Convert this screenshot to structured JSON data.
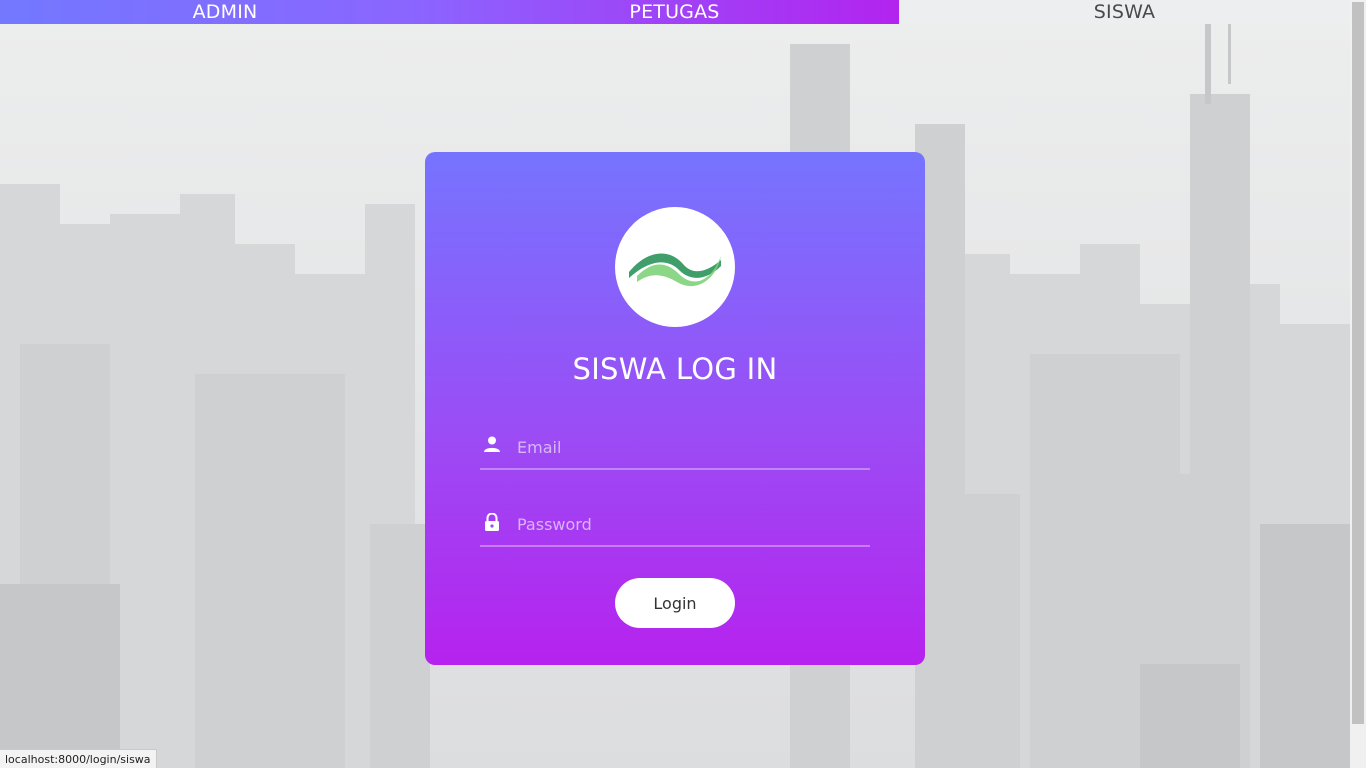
{
  "nav": {
    "tabs": [
      {
        "label": "ADMIN"
      },
      {
        "label": "PETUGAS"
      },
      {
        "label": "SISWA"
      }
    ]
  },
  "login": {
    "title": "SISWA LOG IN",
    "email_placeholder": "Email",
    "password_placeholder": "Password",
    "button_label": "Login"
  },
  "status": {
    "url": "localhost:8000/login/siswa"
  },
  "colors": {
    "gradient_start": "#7378ff",
    "gradient_end": "#b224ef",
    "logo_green_dark": "#3f9e6a",
    "logo_green_light": "#7fd17a"
  },
  "icons": {
    "email": "user-icon",
    "password": "lock-icon",
    "logo": "wave-logo"
  }
}
